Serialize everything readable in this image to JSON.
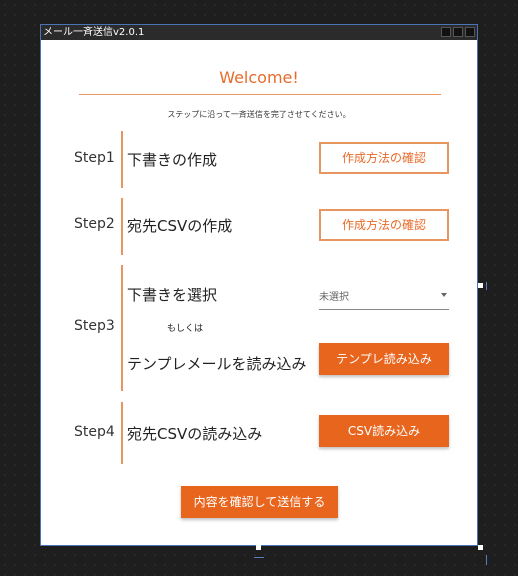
{
  "window": {
    "title": "メール一斉送信v2.0.1"
  },
  "header": {
    "welcome": "Welcome!",
    "subtitle": "ステップに沿って一斉送信を完了させてください。"
  },
  "steps": [
    {
      "label": "Step1",
      "text": "下書きの作成",
      "button": "作成方法の確認"
    },
    {
      "label": "Step2",
      "text": "宛先CSVの作成",
      "button": "作成方法の確認"
    },
    {
      "label": "Step3",
      "text_select": "下書きを選択",
      "or": "もしくは",
      "text_template": "テンプレメールを読み込み",
      "select_value": "未選択",
      "button": "テンプレ読み込み"
    },
    {
      "label": "Step4",
      "text": "宛先CSVの読み込み",
      "button": "CSV読み込み"
    }
  ],
  "footer": {
    "submit": "内容を確認して送信する"
  },
  "colors": {
    "accent": "#e8651e",
    "accent_light": "#e8965f"
  }
}
